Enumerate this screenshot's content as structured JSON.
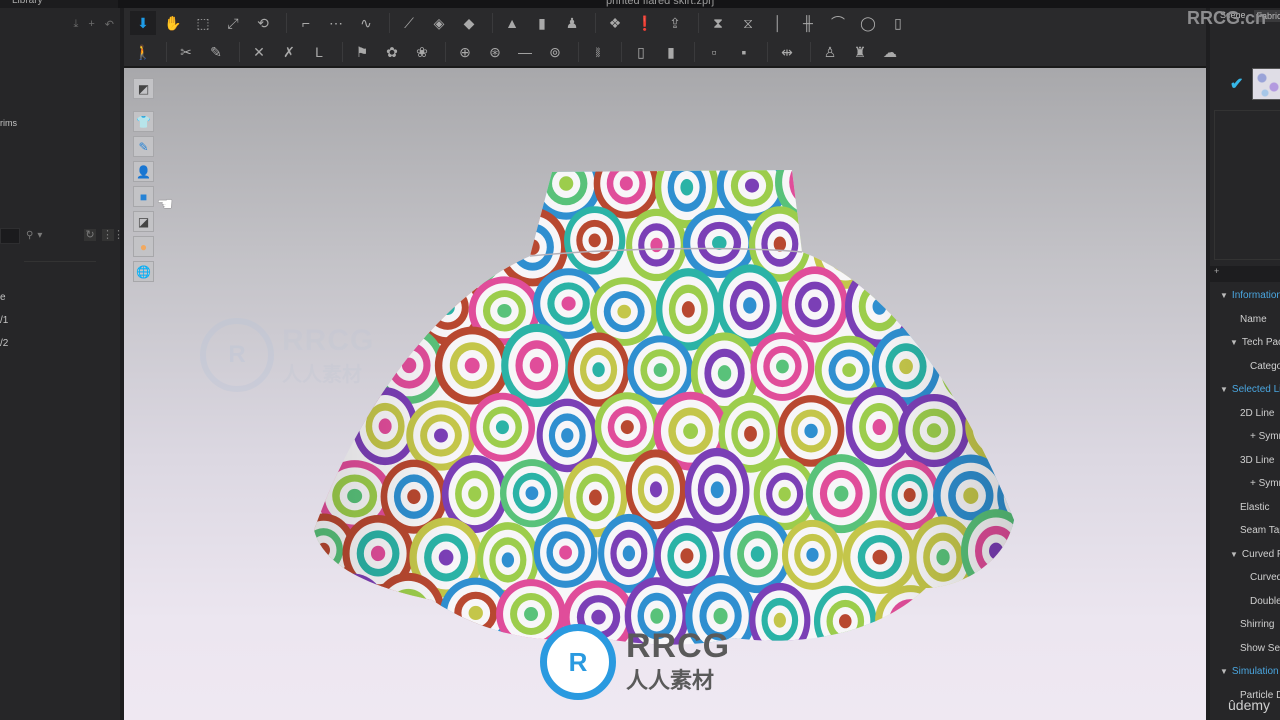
{
  "window": {
    "title": "printed flared skirt.zprj",
    "library_tab": "Library"
  },
  "left_panel": {
    "top_icons": [
      "download-icon",
      "plus-icon",
      "back-arrow-icon"
    ],
    "items": [
      {
        "label": "rims"
      },
      {
        "label": "e"
      },
      {
        "label": "/1"
      },
      {
        "label": "/2"
      }
    ],
    "search": {
      "value": "",
      "placeholder": ""
    },
    "search_tools": [
      "search-icon",
      "dropdown-arrow-icon"
    ],
    "right_tools": [
      "refresh-icon",
      "grid-view-icon"
    ]
  },
  "toolbar_row1": [
    {
      "name": "simulation-toggle",
      "glyph": "⬇",
      "active": true
    },
    {
      "name": "select-move-tool",
      "glyph": "✋"
    },
    {
      "name": "select-box-tool",
      "glyph": "⬚"
    },
    {
      "name": "transform-pattern-tool",
      "glyph": "⤢"
    },
    {
      "name": "fold-arrangement-tool",
      "glyph": "⟲"
    },
    {
      "name": "sep1",
      "sep": true
    },
    {
      "name": "segment-sewing-tool",
      "glyph": "⌐"
    },
    {
      "name": "free-sewing-tool",
      "glyph": "⋯"
    },
    {
      "name": "m-n-sewing-tool",
      "glyph": "∿"
    },
    {
      "name": "sep2",
      "sep": true
    },
    {
      "name": "edit-pin-tool",
      "glyph": "⟋"
    },
    {
      "name": "pin-garment-tool",
      "glyph": "◈"
    },
    {
      "name": "pin-avatar-tool",
      "glyph": "◆"
    },
    {
      "name": "sep3",
      "sep": true
    },
    {
      "name": "arrangement-tool",
      "glyph": "▲"
    },
    {
      "name": "show-avatar-tool",
      "glyph": "▮"
    },
    {
      "name": "fitting-tool",
      "glyph": "♟"
    },
    {
      "name": "sep4",
      "sep": true
    },
    {
      "name": "garment-fit-map-tool",
      "glyph": "❖"
    },
    {
      "name": "strain-map-tool",
      "glyph": "❗"
    },
    {
      "name": "stress-map-tool",
      "glyph": "⇪"
    },
    {
      "name": "sep5",
      "sep": true
    },
    {
      "name": "edit-avatar-measure-tool",
      "glyph": "⧗"
    },
    {
      "name": "avatar-measure-tool",
      "glyph": "⧖"
    },
    {
      "name": "garment-length-tool",
      "glyph": "│"
    },
    {
      "name": "garment-circumference-tool",
      "glyph": "╫"
    },
    {
      "name": "edit-tape-tool",
      "glyph": "⌒"
    },
    {
      "name": "tape-measure-tool",
      "glyph": "◯"
    },
    {
      "name": "ruler-tool",
      "glyph": "▯"
    }
  ],
  "toolbar_row2": [
    {
      "name": "avatar-pose-tool",
      "glyph": "🚶"
    },
    {
      "name": "sep1",
      "sep": true
    },
    {
      "name": "edit-texture-tool",
      "glyph": "✂"
    },
    {
      "name": "texture-brush-tool",
      "glyph": "✎"
    },
    {
      "name": "sep2",
      "sep": true
    },
    {
      "name": "edit-graphic-tool",
      "glyph": "✕"
    },
    {
      "name": "graphic-tool",
      "glyph": "✗"
    },
    {
      "name": "logo-tool",
      "glyph": "L"
    },
    {
      "name": "sep3",
      "sep": true
    },
    {
      "name": "trim-tool",
      "glyph": "⚑"
    },
    {
      "name": "select-trim-tool",
      "glyph": "✿"
    },
    {
      "name": "trims-tool",
      "glyph": "❀"
    },
    {
      "name": "sep4",
      "sep": true
    },
    {
      "name": "select-button-tool",
      "glyph": "⊕"
    },
    {
      "name": "button-tool",
      "glyph": "⊛"
    },
    {
      "name": "buttonhole-tool",
      "glyph": "—"
    },
    {
      "name": "fastening-tool",
      "glyph": "⊚"
    },
    {
      "name": "sep5",
      "sep": true
    },
    {
      "name": "zipper-tool",
      "glyph": "⧚"
    },
    {
      "name": "sep6",
      "sep": true
    },
    {
      "name": "select-piping-tool",
      "glyph": "▯"
    },
    {
      "name": "piping-tool",
      "glyph": "▮"
    },
    {
      "name": "sep7",
      "sep": true
    },
    {
      "name": "select-stitch-tool",
      "glyph": "▫"
    },
    {
      "name": "stitch-tool",
      "glyph": "▪"
    },
    {
      "name": "sep8",
      "sep": true
    },
    {
      "name": "puckering-tool",
      "glyph": "⇹"
    },
    {
      "name": "sep9",
      "sep": true
    },
    {
      "name": "select-fold-tool",
      "glyph": "♙"
    },
    {
      "name": "fold-tool",
      "glyph": "♜"
    },
    {
      "name": "steam-tool",
      "glyph": "☁"
    }
  ],
  "viewport": {
    "side_tools": [
      {
        "name": "view-mode-icon",
        "glyph": "◩",
        "gap": true
      },
      {
        "name": "show-garment-icon",
        "glyph": "👕"
      },
      {
        "name": "show-pattern-icon",
        "glyph": "✎",
        "style": "blue"
      },
      {
        "name": "show-avatar-icon",
        "glyph": "👤"
      },
      {
        "name": "texture-view-icon",
        "glyph": "■",
        "style": "blue"
      },
      {
        "name": "render-surface-icon",
        "glyph": "◪"
      },
      {
        "name": "avatar-skin-icon",
        "glyph": "●",
        "style": "orange"
      },
      {
        "name": "environment-icon",
        "glyph": "🌐",
        "style": "globe"
      }
    ],
    "watermark": {
      "big": "RRCG",
      "small": "人人素材",
      "logo": "R"
    },
    "corner_watermark": "RRCG.cn"
  },
  "right_panel": {
    "tabs": [
      "Scene",
      "Fabric"
    ],
    "fabric_selected": true,
    "property_header": "+",
    "properties": [
      {
        "label": "Information",
        "type": "section",
        "indent": 0
      },
      {
        "label": "Name",
        "type": "field",
        "indent": 2
      },
      {
        "label": "Tech Pack",
        "type": "subsection",
        "indent": 1
      },
      {
        "label": "Category",
        "type": "field",
        "indent": 3
      },
      {
        "label": "Selected Line",
        "type": "section",
        "indent": 0
      },
      {
        "label": "2D Line",
        "type": "field",
        "indent": 2
      },
      {
        "label": "+ Symmetry",
        "type": "field",
        "indent": 3
      },
      {
        "label": "3D Line",
        "type": "field",
        "indent": 2
      },
      {
        "label": "+ Symmetry",
        "type": "field",
        "indent": 3
      },
      {
        "label": "Elastic",
        "type": "field",
        "indent": 2
      },
      {
        "label": "Seam Taping",
        "type": "field",
        "indent": 2
      },
      {
        "label": "Curved Fold",
        "type": "subsection",
        "indent": 1
      },
      {
        "label": "Curved Fold Angle",
        "type": "field",
        "indent": 3
      },
      {
        "label": "Double-sided",
        "type": "field",
        "indent": 3
      },
      {
        "label": "Shirring",
        "type": "field",
        "indent": 2
      },
      {
        "label": "Show Seam",
        "type": "field",
        "indent": 2
      },
      {
        "label": "Simulation",
        "type": "section",
        "indent": 0
      },
      {
        "label": "Particle Distance",
        "type": "field",
        "indent": 2
      }
    ]
  },
  "overlay": {
    "udemy": "ûdemy"
  },
  "colors": {
    "accent": "#1e9be6",
    "section_text": "#4aa6e0",
    "checkmark": "#36b7e8",
    "panel_bg": "#262628",
    "print_colors": [
      "#7b3fb6",
      "#2f8fd0",
      "#e04d9a",
      "#9ccd4c",
      "#2bb3a6",
      "#c4c64a",
      "#b84830",
      "#59c27a"
    ]
  }
}
